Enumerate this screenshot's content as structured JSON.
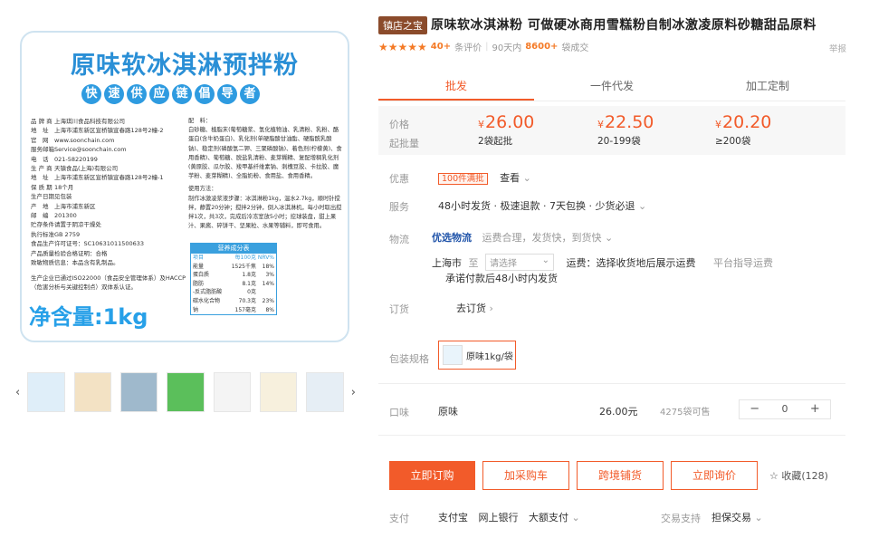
{
  "package": {
    "title": "原味软冰淇淋预拌粉",
    "slogan": [
      "快",
      "速",
      "供",
      "应",
      "链",
      "倡",
      "导",
      "者"
    ],
    "info": [
      [
        "品 牌 商",
        "上海琪川食品科技有限公司"
      ],
      [
        "地　址",
        "上海市浦东新区宣桥镇宣春路128号2幢-2"
      ],
      [
        "官　网",
        "www.soonchain.com"
      ],
      [
        "服务邮箱",
        "Service@soonchain.com"
      ],
      [
        "电　话",
        "021-58220199"
      ],
      [
        "生 产 商",
        "天镇食品(上海)有限公司"
      ],
      [
        "地　址",
        "上海市浦东新区宣桥镇宣春路128号2幢-1"
      ],
      [
        "保 质 期",
        "18个月"
      ],
      [
        "生产日期",
        "见包装"
      ],
      [
        "产　地",
        "上海市浦东新区"
      ],
      [
        "邮　编",
        "201300"
      ],
      [
        "贮存条件",
        "请置于阴凉干燥处"
      ],
      [
        "执行标准",
        "GB 2759"
      ]
    ],
    "license": "食品生产许可证号：SC10631011500633",
    "quality": "产品质量检验合格证明：合格",
    "allergen": "致敏物质信息：本品含有乳制品。",
    "cert": "生产企业已通过ISO22000（食品安全管理体系）及HACCP（危害分析与关键控制点）双体系认证。",
    "ingredients_label": "配　料：",
    "ingredients": "白砂糖、植脂末(葡萄糖浆、氢化植物油、乳清粉、乳粉、酪蛋白(含牛奶蛋白)、乳化剂(单硬脂酸甘油酯、硬脂酰乳酸钠)、稳定剂(磷酸氢二钾、三聚磷酸钠)、着色剂(柠檬黄)、食用香精)、葡萄糖、脱盐乳清粉、麦芽糊精、复配增稠乳化剂(黄原胶、瓜尔胶、羧甲基纤维素钠、刺槐豆胶、卡拉胶、魔芋粉、麦芽糊精)、全脂奶粉、食用盐、食用香精。",
    "usage_label": "使用方法：",
    "usage": "制作冰激凌浆液步骤：冰淇淋粉1kg，温水2.7kg，顺时针搅拌，静置20分钟；搅拌2分钟，倒入冰淇淋机，每小时取出搅拌1次，共3次，完成后冷冻室放5小时；挖球装盘，甜上果汁、果酱、碎饼干、坚果粒、水果等辅料，即可食用。",
    "net": "净含量:1kg",
    "nutrition_title": "营养成分表",
    "nutrition_head": [
      "项目",
      "每100克",
      "NRV%"
    ],
    "nutrition": [
      [
        "能量",
        "1525千焦",
        "18%"
      ],
      [
        "蛋白质",
        "1.8克",
        "3%"
      ],
      [
        "脂肪",
        "8.1克",
        "14%"
      ],
      [
        "-反式脂肪酸",
        "0克",
        ""
      ],
      [
        "碳水化合物",
        "70.3克",
        "23%"
      ],
      [
        "钠",
        "157毫克",
        "8%"
      ]
    ]
  },
  "thumbs": {
    "prev": "‹",
    "next": "›",
    "colors": [
      "#dfeef9",
      "#f3e2c4",
      "#9fb9cc",
      "#5bbf5b",
      "#f4f4f4",
      "#f7f0dd",
      "#e6eef5"
    ]
  },
  "header": {
    "tag": "镇店之宝",
    "title": "原味软冰淇淋粉 可做硬冰商用雪糕粉自制冰激凌原料砂糖甜品原料",
    "stars": "★★★★★",
    "reviews_count": "40+",
    "reviews_label": "条评价",
    "sales_prefix": "90天内",
    "sales_count": "8600+",
    "sales_suffix": "袋成交",
    "report": "举报"
  },
  "tabs": [
    "批发",
    "一件代发",
    "加工定制"
  ],
  "price": {
    "price_label": "价格",
    "qty_label": "起批量",
    "currency": "¥",
    "tiers": [
      {
        "price": "26.00",
        "qty": "2袋起批"
      },
      {
        "price": "22.50",
        "qty": "20-199袋"
      },
      {
        "price": "20.20",
        "qty": "≥200袋"
      }
    ]
  },
  "promo": {
    "label": "优惠",
    "badge": "100件满批",
    "view": "查看",
    "caret": "⌄"
  },
  "service": {
    "label": "服务",
    "text": "48小时发货 · 极速退款 · 7天包换 · 少货必退",
    "caret": "⌄"
  },
  "logistics": {
    "label": "物流",
    "brand": "优选物流",
    "desc": "运费合理，发货快，到货快",
    "caret": "⌄",
    "from": "上海市",
    "to": "至",
    "select_placeholder": "请选择",
    "select_caret": "⌄",
    "freight": "运费：选择收货地后展示运费",
    "guide": "平台指导运费",
    "promise": "承诺付款后48小时内发货"
  },
  "order": {
    "label": "订货",
    "link": "去订货",
    "caret": "›"
  },
  "spec": {
    "label": "包装规格",
    "option": "原味1kg/袋"
  },
  "sku": {
    "label": "口味",
    "name": "原味",
    "price": "26.00元",
    "stock": "4275袋可售",
    "minus": "−",
    "qty": "0",
    "plus": "+"
  },
  "buttons": {
    "buy": "立即订购",
    "cart": "加采购车",
    "cross": "跨境铺货",
    "inquiry": "立即询价",
    "fav_icon": "☆",
    "fav": "收藏(128)"
  },
  "payment": {
    "label": "支付",
    "items": [
      "支付宝",
      "网上银行",
      "大额支付"
    ],
    "caret": "⌄",
    "trade_label": "交易支持",
    "trade": "担保交易",
    "trade_caret": "⌄"
  }
}
